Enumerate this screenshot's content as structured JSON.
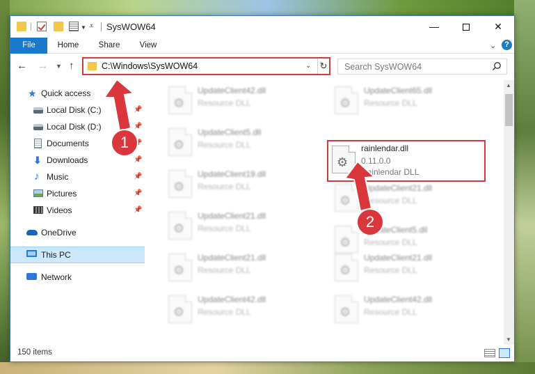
{
  "window": {
    "title": "SysWOW64",
    "controls": {
      "minimize": "—",
      "maximize": "",
      "close": "✕"
    }
  },
  "ribbon": {
    "tabs": [
      "File",
      "Home",
      "Share",
      "View"
    ],
    "help": "?"
  },
  "address": {
    "path": "C:\\Windows\\SysWOW64",
    "refresh": "↻"
  },
  "search": {
    "placeholder": "Search SysWOW64"
  },
  "sidebar": {
    "items": [
      {
        "label": "Quick access",
        "icon": "star-icon"
      },
      {
        "label": "Local Disk (C:)",
        "icon": "disk-icon",
        "pinned": true
      },
      {
        "label": "Local Disk (D:)",
        "icon": "disk-icon",
        "pinned": true
      },
      {
        "label": "Documents",
        "icon": "document-icon",
        "pinned": true
      },
      {
        "label": "Downloads",
        "icon": "download-icon",
        "pinned": true
      },
      {
        "label": "Music",
        "icon": "music-icon",
        "pinned": true
      },
      {
        "label": "Pictures",
        "icon": "picture-icon",
        "pinned": true
      },
      {
        "label": "Videos",
        "icon": "video-icon",
        "pinned": true
      },
      {
        "label": "OneDrive",
        "icon": "cloud-icon"
      },
      {
        "label": "This PC",
        "icon": "computer-icon",
        "selected": true
      },
      {
        "label": "Network",
        "icon": "network-icon"
      }
    ]
  },
  "files": {
    "left": [
      {
        "name": "UpdateClient42.dll",
        "type": "Resource DLL"
      },
      {
        "name": "UpdateClient5.dll",
        "type": "Resource DLL"
      },
      {
        "name": "UpdateClient19.dll",
        "type": "Resource DLL"
      },
      {
        "name": "UpdateClient21.dll",
        "type": "Resource DLL"
      },
      {
        "name": "UpdateClient21.dll",
        "type": "Resource DLL"
      },
      {
        "name": "UpdateClient42.dll",
        "type": "Resource DLL"
      }
    ],
    "right": [
      {
        "name": "UpdateClient65.dll",
        "type": "Resource DLL"
      },
      {
        "name": "rainlendar.dll",
        "version": "0.11.0.0",
        "description": "Rainlendar DLL",
        "highlighted": true
      },
      {
        "name": "UpdateClient21.dll",
        "type": "Resource DLL"
      },
      {
        "name": "UpdateClient5.dll",
        "type": "Resource DLL"
      },
      {
        "name": "UpdateClient21.dll",
        "type": "Resource DLL"
      },
      {
        "name": "UpdateClient42.dll",
        "type": "Resource DLL"
      }
    ]
  },
  "status": {
    "count": "150 items"
  },
  "annotations": {
    "step1": "1",
    "step2": "2",
    "color": "#d9373b"
  }
}
